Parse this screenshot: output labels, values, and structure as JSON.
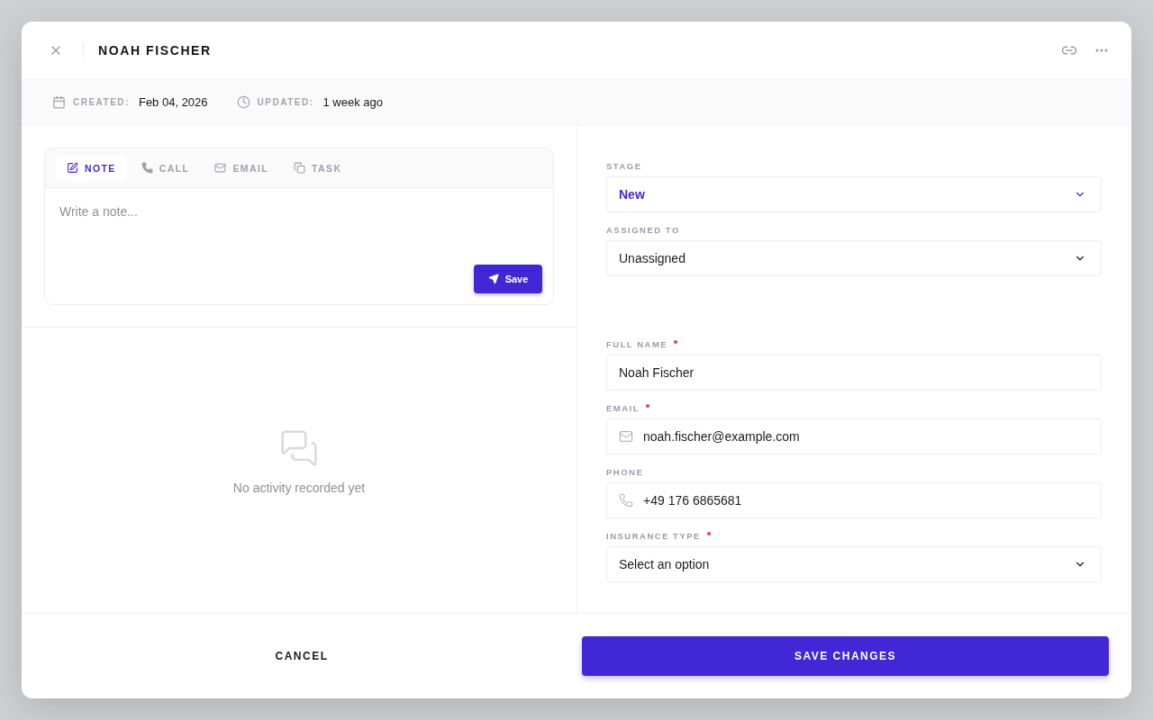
{
  "modal": {
    "title": "NOAH FISCHER"
  },
  "meta": [
    {
      "kind": "calendar",
      "label": "CREATED:",
      "value": "Feb 04, 2026"
    },
    {
      "kind": "clock",
      "label": "UPDATED:",
      "value": "1 week ago"
    }
  ],
  "composer": {
    "tabs": [
      {
        "kind": "note",
        "label": "NOTE",
        "selected": true
      },
      {
        "kind": "call",
        "label": "CALL",
        "selected": false
      },
      {
        "kind": "email",
        "label": "EMAIL",
        "selected": false
      },
      {
        "kind": "task",
        "label": "TASK",
        "selected": false
      }
    ],
    "placeholder": "Write a note...",
    "save": "Save"
  },
  "activity": {
    "empty": "No activity recorded yet"
  },
  "pipeline": [
    {
      "kind": "stage",
      "label": "STAGE",
      "required": false,
      "value": "New"
    },
    {
      "kind": "select",
      "label": "ASSIGNED TO",
      "required": false,
      "value": "Unassigned"
    }
  ],
  "contact": [
    {
      "kind": "text",
      "label": "FULL NAME",
      "required": true,
      "value": "Noah Fischer"
    },
    {
      "kind": "email",
      "label": "EMAIL",
      "required": true,
      "value": "noah.fischer@example.com"
    },
    {
      "kind": "phone",
      "label": "PHONE",
      "required": false,
      "value": "+49 176 6865681"
    },
    {
      "kind": "select",
      "label": "INSURANCE TYPE",
      "required": true,
      "value": "Select an option"
    }
  ],
  "footer": {
    "cancel": "CANCEL",
    "save": "SAVE CHANGES"
  }
}
